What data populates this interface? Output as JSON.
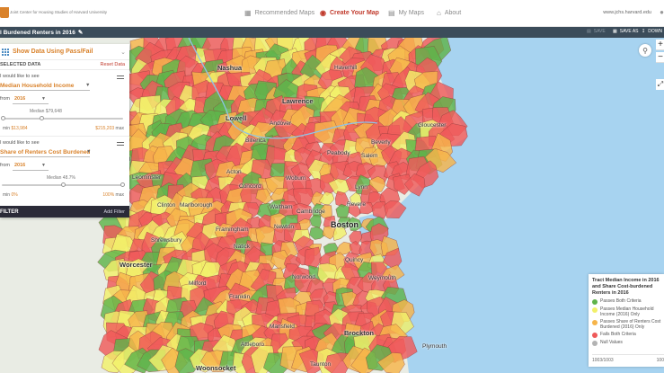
{
  "header": {
    "org_name": "Joint Center for Housing Studies of Harvard University",
    "nav": [
      {
        "label": "Recommended Maps",
        "icon": "image-gallery-icon",
        "active": false
      },
      {
        "label": "Create Your Map",
        "icon": "map-pin-icon",
        "active": true
      },
      {
        "label": "My Maps",
        "icon": "folder-icon",
        "active": false
      },
      {
        "label": "About",
        "icon": "bank-icon",
        "active": false
      }
    ],
    "user_email": "www.jchs.harvard.edu"
  },
  "titlebar": {
    "map_title": "l Burdened Renters in 2016",
    "actions": [
      {
        "label": "SAVE",
        "icon": "save-icon",
        "enabled": false
      },
      {
        "label": "SAVE AS",
        "icon": "copy-icon",
        "enabled": true
      },
      {
        "label": "DOWN",
        "icon": "download-icon",
        "enabled": true
      }
    ]
  },
  "panel": {
    "header_label": "Show Data Using Pass/Fail",
    "selected_data_label": "SELECTED DATA",
    "reset_label": "Reset Data",
    "variables": [
      {
        "prompt": "I would like to see",
        "name": "Median Household Income",
        "from_label": "from",
        "year": "2016",
        "median_label": "Median $79,648",
        "min_label": "min",
        "min_value": "$13,984",
        "max_value": "$215,203",
        "max_label": "max"
      },
      {
        "prompt": "I would like to see",
        "name": "Share of Renters Cost Burdened",
        "from_label": "from",
        "year": "2016",
        "median_label": "Median 48.7%",
        "min_label": "min",
        "min_value": "0%",
        "max_value": "100%",
        "max_label": "max"
      }
    ],
    "filter_label": "FILTER",
    "add_filter_label": "Add Filter"
  },
  "map": {
    "places": [
      {
        "name": "Nashua",
        "size": "med"
      },
      {
        "name": "Lowell",
        "size": "med"
      },
      {
        "name": "Lawrence",
        "size": "med"
      },
      {
        "name": "Haverhill",
        "size": "norm"
      },
      {
        "name": "Andover",
        "size": "norm"
      },
      {
        "name": "Peabody",
        "size": "norm"
      },
      {
        "name": "Salem",
        "size": "norm"
      },
      {
        "name": "Beverly",
        "size": "norm"
      },
      {
        "name": "Gloucester",
        "size": "norm"
      },
      {
        "name": "Boston",
        "size": "big"
      },
      {
        "name": "Cambridge",
        "size": "norm"
      },
      {
        "name": "Quincy",
        "size": "norm"
      },
      {
        "name": "Framingham",
        "size": "norm"
      },
      {
        "name": "Worcester",
        "size": "med"
      },
      {
        "name": "Brockton",
        "size": "med"
      },
      {
        "name": "Woonsocket",
        "size": "med"
      },
      {
        "name": "Marlborough",
        "size": "norm"
      },
      {
        "name": "Leominster",
        "size": "norm"
      },
      {
        "name": "Fitchburg",
        "size": "norm"
      },
      {
        "name": "Acton",
        "size": "norm"
      },
      {
        "name": "Concord",
        "size": "norm"
      },
      {
        "name": "Waltham",
        "size": "norm"
      },
      {
        "name": "Newton",
        "size": "norm"
      },
      {
        "name": "Natick",
        "size": "norm"
      },
      {
        "name": "Norwood",
        "size": "norm"
      },
      {
        "name": "Weymouth",
        "size": "norm"
      },
      {
        "name": "Milford",
        "size": "norm"
      },
      {
        "name": "Franklin",
        "size": "norm"
      },
      {
        "name": "Taunton",
        "size": "norm"
      },
      {
        "name": "Plymouth",
        "size": "norm"
      },
      {
        "name": "Clinton",
        "size": "norm"
      },
      {
        "name": "Shrewsbury",
        "size": "norm"
      },
      {
        "name": "Billerica",
        "size": "norm"
      },
      {
        "name": "Woburn",
        "size": "norm"
      },
      {
        "name": "Lynn",
        "size": "norm"
      },
      {
        "name": "Revere",
        "size": "norm"
      },
      {
        "name": "Mansfield",
        "size": "norm"
      },
      {
        "name": "Attleboro",
        "size": "norm"
      }
    ]
  },
  "legend": {
    "title": "Tract Median Income in 2016 and Share Cost-burdened Renters in 2016",
    "items": [
      {
        "label": "Passes Both Criteria",
        "color": "#5fb34a"
      },
      {
        "label": "Passes Median Household Income (2016) Only",
        "color": "#f2f06a"
      },
      {
        "label": "Passes Share of Renters Cost Burdened (2016) Only",
        "color": "#f6b44a"
      },
      {
        "label": "Fails Both Criteria",
        "color": "#ef5a5a"
      },
      {
        "label": "Null Values",
        "color": "#b3b3b3"
      }
    ],
    "footer_left": "1003/1003",
    "footer_right": "100"
  },
  "colors": {
    "accent": "#d9822b",
    "active_nav": "#c0392b",
    "titlebar": "#3b4c5a",
    "water": "#a7d3f0",
    "land": "#e9ece4"
  }
}
